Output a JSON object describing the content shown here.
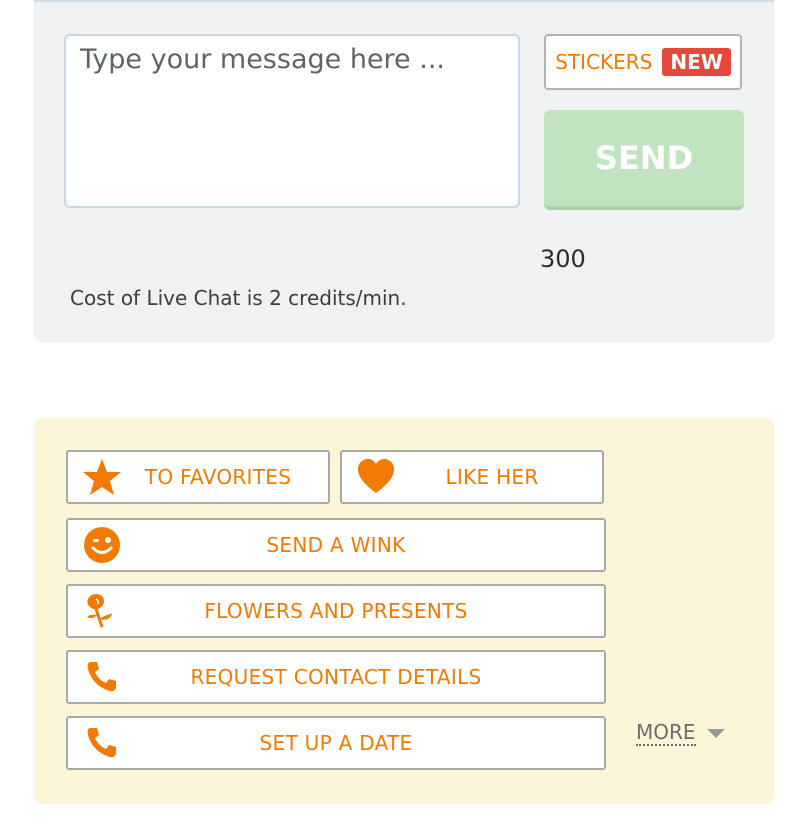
{
  "chat": {
    "message_placeholder": "Type your message here ...",
    "stickers_label": "STICKERS",
    "new_badge": "NEW",
    "send_label": "SEND",
    "char_counter": "300",
    "cost_text": "Cost of Live Chat is 2 credits/min."
  },
  "actions": {
    "to_favorites": "TO FAVORITES",
    "like_her": "LIKE HER",
    "send_wink": "SEND A WINK",
    "flowers_presents": "FLOWERS AND PRESENTS",
    "request_contact": "REQUEST CONTACT DETAILS",
    "set_up_date": "SET UP A DATE",
    "more_label": "MORE"
  },
  "icons": {
    "favorites": "star-icon",
    "like": "heart-icon",
    "wink": "wink-smiley-icon",
    "flowers": "rose-icon",
    "contact": "phone-icon",
    "date": "phone-icon",
    "more": "caret-down-icon"
  },
  "colors": {
    "accent": "#f27a00",
    "send_disabled": "#c1e3c0",
    "new_badge": "#e8473c",
    "actions_bg": "#fdf5d7",
    "chat_bg": "#f0f1f3"
  }
}
